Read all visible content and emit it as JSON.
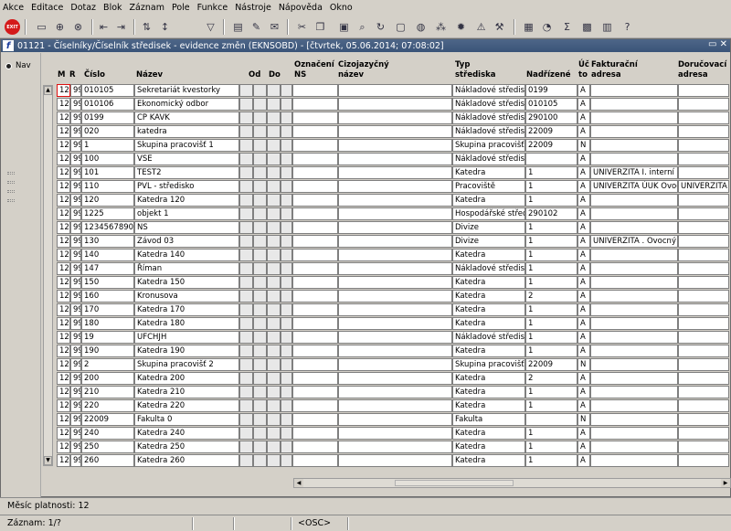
{
  "menu": [
    "Akce",
    "Editace",
    "Dotaz",
    "Blok",
    "Záznam",
    "Pole",
    "Funkce",
    "Nástroje",
    "Nápověda",
    "Okno"
  ],
  "toolbar": {
    "exit_label": "EXIT",
    "icons": [
      "save-icon",
      "new-record-icon",
      "delete-record-icon",
      "first-icon",
      "last-icon",
      "sort-asc-icon",
      "sort-desc-icon",
      "filter-icon",
      "print-icon",
      "edit-icon",
      "mail-icon",
      "cut-icon",
      "copy-icon",
      "paste-icon",
      "search-icon",
      "refresh-icon",
      "globe-icon",
      "warning-icon",
      "gear-icon",
      "tools-icon",
      "export-icon",
      "disk-icon",
      "sum-icon",
      "excel-icon",
      "grid-icon",
      "help-icon"
    ]
  },
  "window": {
    "title": "01121 - Číselníky/Číselník středisek - evidence změn (EKNSOBD) - [čtvrtek, 05.06.2014; 07:08:02]",
    "buttons": "▭ ✕"
  },
  "nav": {
    "label": "Nav"
  },
  "columns": {
    "m": "M",
    "r": "R",
    "cislo": "Číslo",
    "nazev": "Název",
    "od": "Od",
    "do": "Do",
    "ozn1": "Označení",
    "ozn2": "NS",
    "ciz1": "Cizojazyčný",
    "ciz2": "název",
    "typ1": "Typ",
    "typ2": "střediska",
    "nadr": "Nadřízené",
    "uc1": "Úč",
    "uc2": "to",
    "fak1": "Fakturační",
    "fak2": "adresa",
    "dor1": "Doručovací",
    "dor2": "adresa"
  },
  "rows": [
    {
      "m": "12",
      "r": "99",
      "cislo": "010105",
      "nazev": "Sekretariát kvestorky",
      "typ": "Nákladové středisko",
      "nadr": "0199",
      "uc": "A",
      "fak": "",
      "dor": ""
    },
    {
      "m": "12",
      "r": "99",
      "cislo": "010106",
      "nazev": "Ekonomický odbor",
      "typ": "Nákladové středisko",
      "nadr": "010105",
      "uc": "A",
      "fak": "",
      "dor": ""
    },
    {
      "m": "12",
      "r": "99",
      "cislo": "0199",
      "nazev": "CP KAVK",
      "typ": "Nákladové středisko",
      "nadr": "290100",
      "uc": "A",
      "fak": "",
      "dor": ""
    },
    {
      "m": "12",
      "r": "99",
      "cislo": "020",
      "nazev": "katedra",
      "typ": "Nákladové středisko",
      "nadr": "22009",
      "uc": "A",
      "fak": "",
      "dor": ""
    },
    {
      "m": "12",
      "r": "99",
      "cislo": "1",
      "nazev": "Skupina pracovišť 1",
      "typ": "Skupina pracovišť",
      "nadr": "22009",
      "uc": "N",
      "fak": "",
      "dor": ""
    },
    {
      "m": "12",
      "r": "99",
      "cislo": "100",
      "nazev": "VSE",
      "typ": "Nákladové středisko",
      "nadr": "",
      "uc": "A",
      "fak": "",
      "dor": ""
    },
    {
      "m": "12",
      "r": "99",
      "cislo": "101",
      "nazev": "TEST2",
      "typ": "Katedra",
      "nadr": "1",
      "uc": "A",
      "fak": "UNIVERZITA  I. interní kli",
      "dor": ""
    },
    {
      "m": "12",
      "r": "99",
      "cislo": "110",
      "nazev": "PVL - středisko",
      "typ": "Pracoviště",
      "nadr": "1",
      "uc": "A",
      "fak": "UNIVERZITA ÚUK Ovocn",
      "dor": "UNIVERZITA ."
    },
    {
      "m": "12",
      "r": "99",
      "cislo": "120",
      "nazev": "Katedra 120",
      "typ": "Katedra",
      "nadr": "1",
      "uc": "A",
      "fak": "",
      "dor": ""
    },
    {
      "m": "12",
      "r": "99",
      "cislo": "1225",
      "nazev": "objekt 1",
      "typ": "Hospodářské středisko",
      "nadr": "290102",
      "uc": "A",
      "fak": "",
      "dor": ""
    },
    {
      "m": "12",
      "r": "99",
      "cislo": "1234567890",
      "nazev": "NS",
      "typ": "Divize",
      "nadr": "1",
      "uc": "A",
      "fak": "",
      "dor": ""
    },
    {
      "m": "12",
      "r": "99",
      "cislo": "130",
      "nazev": "Závod 03",
      "typ": "Divize",
      "nadr": "1",
      "uc": "A",
      "fak": "UNIVERZITA . Ovocný tr",
      "dor": ""
    },
    {
      "m": "12",
      "r": "99",
      "cislo": "140",
      "nazev": "Katedra 140",
      "typ": "Katedra",
      "nadr": "1",
      "uc": "A",
      "fak": "",
      "dor": ""
    },
    {
      "m": "12",
      "r": "99",
      "cislo": "147",
      "nazev": "Říman",
      "typ": "Nákladové středisko",
      "nadr": "1",
      "uc": "A",
      "fak": "",
      "dor": ""
    },
    {
      "m": "12",
      "r": "99",
      "cislo": "150",
      "nazev": "Katedra 150",
      "typ": "Katedra",
      "nadr": "1",
      "uc": "A",
      "fak": "",
      "dor": ""
    },
    {
      "m": "12",
      "r": "99",
      "cislo": "160",
      "nazev": "Kronusova",
      "typ": "Katedra",
      "nadr": "2",
      "uc": "A",
      "fak": "",
      "dor": ""
    },
    {
      "m": "12",
      "r": "99",
      "cislo": "170",
      "nazev": "Katedra 170",
      "typ": "Katedra",
      "nadr": "1",
      "uc": "A",
      "fak": "",
      "dor": ""
    },
    {
      "m": "12",
      "r": "99",
      "cislo": "180",
      "nazev": "Katedra 180",
      "typ": "Katedra",
      "nadr": "1",
      "uc": "A",
      "fak": "",
      "dor": ""
    },
    {
      "m": "12",
      "r": "99",
      "cislo": "19",
      "nazev": "UFCHJH",
      "typ": "Nákladové středisko",
      "nadr": "1",
      "uc": "A",
      "fak": "",
      "dor": ""
    },
    {
      "m": "12",
      "r": "99",
      "cislo": "190",
      "nazev": "Katedra 190",
      "typ": "Katedra",
      "nadr": "1",
      "uc": "A",
      "fak": "",
      "dor": ""
    },
    {
      "m": "12",
      "r": "99",
      "cislo": "2",
      "nazev": "Skupina pracovišť 2",
      "typ": "Skupina pracovišť",
      "nadr": "22009",
      "uc": "N",
      "fak": "",
      "dor": ""
    },
    {
      "m": "12",
      "r": "99",
      "cislo": "200",
      "nazev": "Katedra 200",
      "typ": "Katedra",
      "nadr": "2",
      "uc": "A",
      "fak": "",
      "dor": ""
    },
    {
      "m": "12",
      "r": "99",
      "cislo": "210",
      "nazev": "Katedra 210",
      "typ": "Katedra",
      "nadr": "1",
      "uc": "A",
      "fak": "",
      "dor": ""
    },
    {
      "m": "12",
      "r": "99",
      "cislo": "220",
      "nazev": "Katedra 220",
      "typ": "Katedra",
      "nadr": "1",
      "uc": "A",
      "fak": "",
      "dor": ""
    },
    {
      "m": "12",
      "r": "99",
      "cislo": "22009",
      "nazev": "Fakulta 0",
      "typ": "Fakulta",
      "nadr": "",
      "uc": "N",
      "fak": "",
      "dor": ""
    },
    {
      "m": "12",
      "r": "99",
      "cislo": "240",
      "nazev": "Katedra 240",
      "typ": "Katedra",
      "nadr": "1",
      "uc": "A",
      "fak": "",
      "dor": ""
    },
    {
      "m": "12",
      "r": "99",
      "cislo": "250",
      "nazev": "Katedra 250",
      "typ": "Katedra",
      "nadr": "1",
      "uc": "A",
      "fak": "",
      "dor": ""
    },
    {
      "m": "12",
      "r": "99",
      "cislo": "260",
      "nazev": "Katedra 260",
      "typ": "Katedra",
      "nadr": "1",
      "uc": "A",
      "fak": "",
      "dor": ""
    }
  ],
  "status": {
    "line1": "Měsíc platnosti: 12",
    "record": "Záznam: 1/?",
    "mode": "<OSC>"
  }
}
